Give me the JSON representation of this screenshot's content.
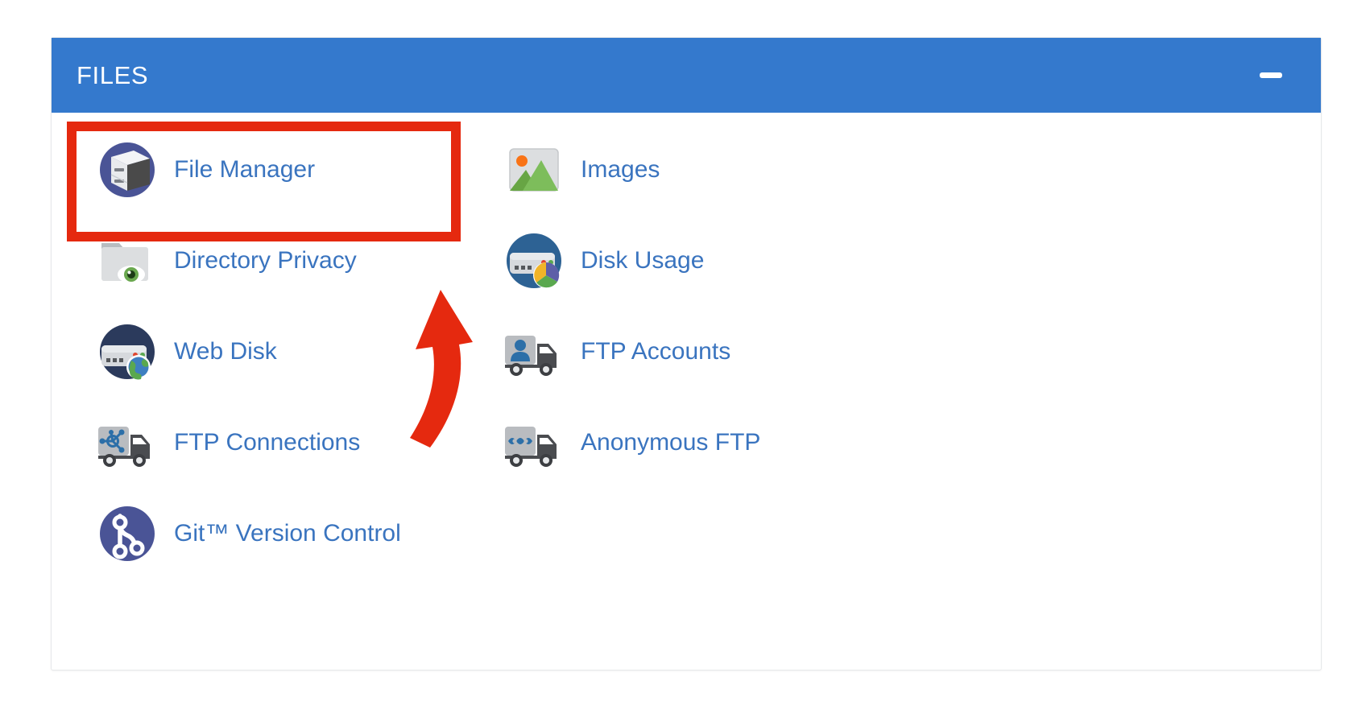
{
  "panel": {
    "title": "FILES",
    "header_color": "#3479cd",
    "link_color": "#3a74bf",
    "minimize": {
      "icon": "minus-icon",
      "label": "Minimize"
    }
  },
  "annotations": {
    "highlight": {
      "color": "#e5290f",
      "target": "File Manager"
    },
    "arrow": {
      "color": "#e5290f",
      "direction": "up",
      "target": "File Manager"
    }
  },
  "tiles": [
    {
      "label": "File Manager",
      "icon": "file-cabinet-icon"
    },
    {
      "label": "Images",
      "icon": "picture-icon"
    },
    {
      "label": "Directory Privacy",
      "icon": "folder-eye-icon"
    },
    {
      "label": "Disk Usage",
      "icon": "server-pie-chart-icon"
    },
    {
      "label": "Web Disk",
      "icon": "server-globe-icon"
    },
    {
      "label": "FTP Accounts",
      "icon": "truck-person-icon"
    },
    {
      "label": "FTP Connections",
      "icon": "truck-network-icon"
    },
    {
      "label": "Anonymous FTP",
      "icon": "truck-mask-icon"
    },
    {
      "label": "Git™ Version Control",
      "icon": "git-branch-icon"
    }
  ]
}
